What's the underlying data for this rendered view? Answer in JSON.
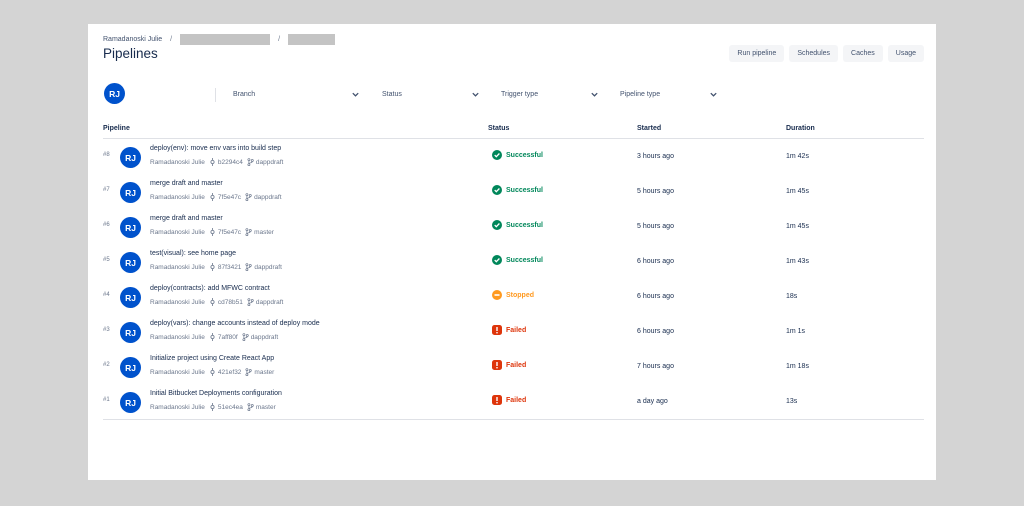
{
  "breadcrumb": {
    "owner": "Ramadanoski Julie",
    "separator": "/"
  },
  "page_title": "Pipelines",
  "actions": {
    "run_pipeline": "Run pipeline",
    "schedules": "Schedules",
    "caches": "Caches",
    "usage": "Usage"
  },
  "filters": {
    "avatar_initials": "RJ",
    "branch": "Branch",
    "status": "Status",
    "trigger_type": "Trigger type",
    "pipeline_type": "Pipeline type"
  },
  "table": {
    "headers": {
      "pipeline": "Pipeline",
      "status": "Status",
      "started": "Started",
      "duration": "Duration"
    },
    "rows": [
      {
        "num": "#8",
        "initials": "RJ",
        "message": "deploy(env): move env vars into build step",
        "author": "Ramadanoski Julie",
        "commit": "b2294c4",
        "branch": "dappdraft",
        "status": "Successful",
        "started": "3 hours ago",
        "duration": "1m 42s"
      },
      {
        "num": "#7",
        "initials": "RJ",
        "message": "merge draft and master",
        "author": "Ramadanoski Julie",
        "commit": "7f5e47c",
        "branch": "dappdraft",
        "status": "Successful",
        "started": "5 hours ago",
        "duration": "1m 45s"
      },
      {
        "num": "#6",
        "initials": "RJ",
        "message": "merge draft and master",
        "author": "Ramadanoski Julie",
        "commit": "7f5e47c",
        "branch": "master",
        "status": "Successful",
        "started": "5 hours ago",
        "duration": "1m 45s"
      },
      {
        "num": "#5",
        "initials": "RJ",
        "message": "test(visual): see home page",
        "author": "Ramadanoski Julie",
        "commit": "87f3421",
        "branch": "dappdraft",
        "status": "Successful",
        "started": "6 hours ago",
        "duration": "1m 43s"
      },
      {
        "num": "#4",
        "initials": "RJ",
        "message": "deploy(contracts): add MFWC contract",
        "author": "Ramadanoski Julie",
        "commit": "cd78b51",
        "branch": "dappdraft",
        "status": "Stopped",
        "started": "6 hours ago",
        "duration": "18s"
      },
      {
        "num": "#3",
        "initials": "RJ",
        "message": "deploy(vars): change accounts instead of deploy mode",
        "author": "Ramadanoski Julie",
        "commit": "7aff80f",
        "branch": "dappdraft",
        "status": "Failed",
        "started": "6 hours ago",
        "duration": "1m 1s"
      },
      {
        "num": "#2",
        "initials": "RJ",
        "message": "Initialize project using Create React App",
        "author": "Ramadanoski Julie",
        "commit": "421ef32",
        "branch": "master",
        "status": "Failed",
        "started": "7 hours ago",
        "duration": "1m 18s"
      },
      {
        "num": "#1",
        "initials": "RJ",
        "message": "Initial Bitbucket Deployments configuration",
        "author": "Ramadanoski Julie",
        "commit": "51ec4ea",
        "branch": "master",
        "status": "Failed",
        "started": "a day ago",
        "duration": "13s"
      }
    ]
  },
  "colors": {
    "successful": "#00875a",
    "stopped": "#ff991f",
    "failed": "#de350b",
    "avatar": "#0052cc"
  },
  "icons": {
    "commit": "commit-icon",
    "branch": "branch-icon",
    "successful": "check-circle-icon",
    "stopped": "stop-circle-icon",
    "failed": "error-icon",
    "dropdown": "chevron-down-icon"
  }
}
